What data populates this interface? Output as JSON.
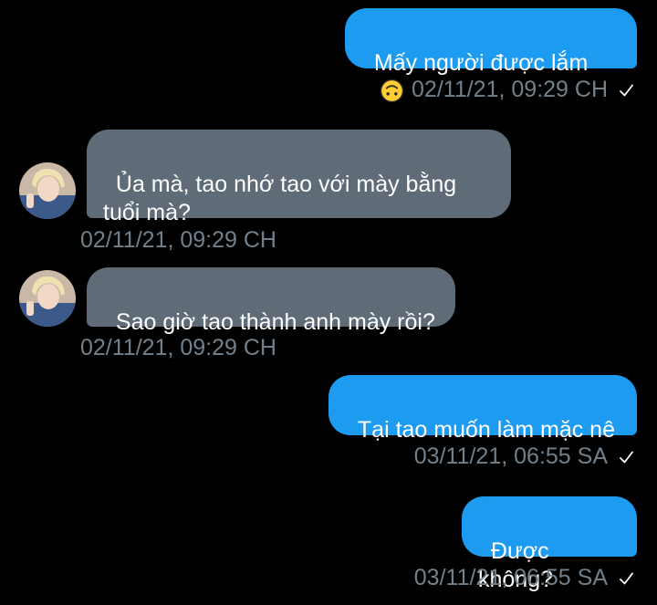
{
  "colors": {
    "background": "#000000",
    "outgoing_bubble": "#1d9bf0",
    "incoming_bubble": "#5f6b77",
    "timestamp": "#72808b",
    "text": "#ffffff"
  },
  "messages": [
    {
      "direction": "outgoing",
      "text": "Mấy người được lắm",
      "emoji": "upside-down-face-icon",
      "timestamp": "02/11/21, 09:29 CH",
      "status": "sent-check-icon"
    },
    {
      "direction": "incoming",
      "text": "Ủa mà, tao nhớ tao với mày bằng\ntuổi mà?",
      "timestamp": "02/11/21, 09:29 CH",
      "avatar": "contact-avatar"
    },
    {
      "direction": "incoming",
      "text": "Sao giờ tao thành anh mày rồi?",
      "timestamp": "02/11/21, 09:29 CH",
      "avatar": "contact-avatar"
    },
    {
      "direction": "outgoing",
      "text": "Tại tao muốn làm mặc nê",
      "timestamp": "03/11/21, 06:55 SA",
      "status": "sent-check-icon"
    },
    {
      "direction": "outgoing",
      "text": "Được không?",
      "timestamp": "03/11/21, 06:55 SA",
      "status": "sent-check-icon"
    }
  ]
}
